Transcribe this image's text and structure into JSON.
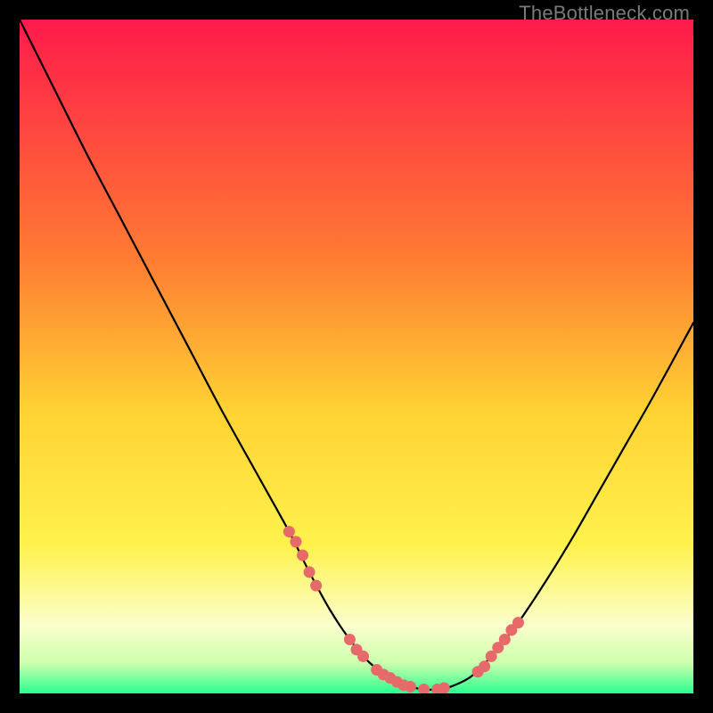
{
  "watermark": "TheBottleneck.com",
  "colors": {
    "gradient_top": "#ff1a4b",
    "gradient_mid1": "#ff7a33",
    "gradient_mid2": "#ffd233",
    "gradient_mid3": "#fff24d",
    "gradient_pale": "#faffcc",
    "gradient_green": "#29ff8f",
    "curve": "#000000",
    "dots": "#e66a6a",
    "frame": "#000000"
  },
  "chart_data": {
    "type": "line",
    "title": "",
    "xlabel": "",
    "ylabel": "",
    "xlim": [
      0,
      100
    ],
    "ylim": [
      0,
      100
    ],
    "series": [
      {
        "name": "bottleneck-curve",
        "x": [
          0,
          5,
          10,
          15,
          20,
          25,
          30,
          35,
          40,
          43,
          46,
          49,
          52,
          55,
          58,
          60,
          62,
          64,
          67,
          70,
          74,
          78,
          82,
          86,
          90,
          94,
          100
        ],
        "y": [
          100,
          90,
          80,
          70.5,
          61,
          51.5,
          42,
          33,
          24,
          18,
          12.5,
          8,
          4.5,
          2.3,
          1.0,
          0.6,
          0.6,
          1.0,
          2.5,
          5.5,
          10.5,
          16.5,
          23,
          30,
          37,
          44,
          55
        ]
      },
      {
        "name": "highlight-dots",
        "x": [
          40,
          41,
          42,
          43,
          44,
          49,
          50,
          51,
          53,
          54,
          55,
          56,
          57,
          58,
          60,
          62,
          63,
          68,
          69,
          70,
          71,
          72,
          73,
          74
        ],
        "y": [
          24,
          22.5,
          20.5,
          18,
          16,
          8,
          6.5,
          5.5,
          3.5,
          2.8,
          2.3,
          1.7,
          1.2,
          1.0,
          0.6,
          0.6,
          0.8,
          3.2,
          4.0,
          5.5,
          6.8,
          8.0,
          9.4,
          10.5
        ]
      }
    ],
    "gradient_stops": [
      {
        "pos": 0.0,
        "color": "#ff1a4b"
      },
      {
        "pos": 0.35,
        "color": "#ff7a33"
      },
      {
        "pos": 0.58,
        "color": "#ffd233"
      },
      {
        "pos": 0.78,
        "color": "#fff24d"
      },
      {
        "pos": 0.9,
        "color": "#faffcc"
      },
      {
        "pos": 0.955,
        "color": "#ccffad"
      },
      {
        "pos": 1.0,
        "color": "#29ff8f"
      }
    ]
  }
}
